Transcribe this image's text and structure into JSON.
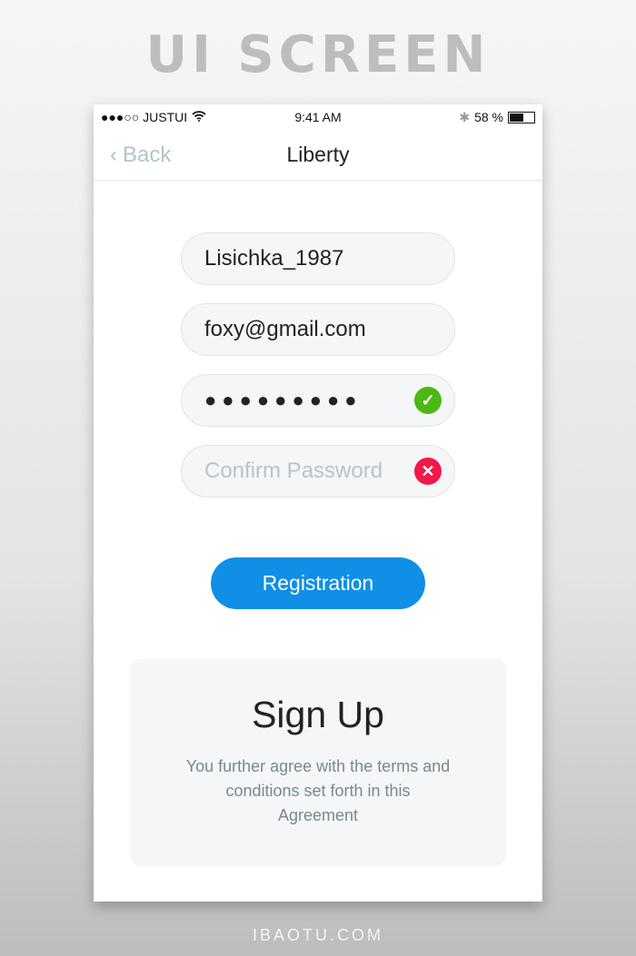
{
  "banner": "UI SCREEN",
  "footer": "IBAOTU.COM",
  "status": {
    "carrier": "●●●○○ JUSTUI",
    "time": "9:41 AM",
    "battery": "58 %",
    "battery_level": 0.58
  },
  "nav": {
    "back": "Back",
    "title": "Liberty"
  },
  "form": {
    "username": "Lisichka_1987",
    "email": "foxy@gmail.com",
    "password": "●●●●●●●●●",
    "confirm_placeholder": "Confirm Password",
    "button": "Registration"
  },
  "colors": {
    "accent": "#0f8fe6",
    "success": "#4cb814",
    "error": "#f2184a"
  },
  "card": {
    "title": "Sign Up",
    "text": "You further agree with the terms and conditions set forth in this Agreement"
  }
}
